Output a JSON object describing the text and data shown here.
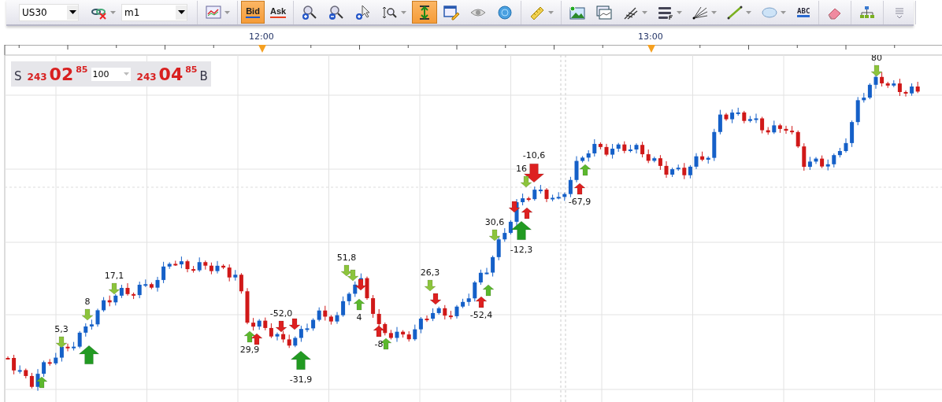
{
  "toolbar": {
    "groups": [
      {
        "items": [
          {
            "kind": "symbol-select",
            "value": "US30"
          },
          {
            "kind": "link",
            "selected": false,
            "dropdown": true
          },
          {
            "kind": "timeframe-select",
            "value": "m1"
          }
        ]
      },
      {
        "items": [
          {
            "kind": "chart-type",
            "selected": false,
            "dropdown": true
          }
        ]
      },
      {
        "items": [
          {
            "kind": "price-bid",
            "text": "Bid",
            "selected": true
          },
          {
            "kind": "price-ask",
            "text": "Ask",
            "selected": false
          }
        ]
      },
      {
        "items": [
          {
            "kind": "zoom-in",
            "selected": false
          },
          {
            "kind": "zoom-out",
            "selected": false
          },
          {
            "kind": "zoom-cursor",
            "selected": false
          },
          {
            "kind": "zoom-range",
            "selected": false,
            "dropdown": true
          },
          {
            "kind": "autoscale",
            "selected": true
          },
          {
            "kind": "properties",
            "selected": false
          },
          {
            "kind": "eye",
            "selected": false
          },
          {
            "kind": "globe",
            "selected": false
          }
        ]
      },
      {
        "items": [
          {
            "kind": "ruler",
            "selected": false,
            "dropdown": true
          }
        ]
      },
      {
        "items": [
          {
            "kind": "image",
            "selected": false
          },
          {
            "kind": "window",
            "selected": false
          },
          {
            "kind": "pitchfork",
            "selected": false,
            "dropdown": true
          },
          {
            "kind": "levels",
            "selected": false,
            "dropdown": true
          },
          {
            "kind": "fan",
            "selected": false,
            "dropdown": true
          },
          {
            "kind": "line",
            "selected": false,
            "dropdown": true
          },
          {
            "kind": "ellipse",
            "selected": false,
            "dropdown": true
          },
          {
            "kind": "text-tool",
            "text": "ABC",
            "selected": false
          }
        ]
      },
      {
        "items": [
          {
            "kind": "eraser",
            "selected": false
          }
        ]
      },
      {
        "items": [
          {
            "kind": "tree",
            "selected": false
          }
        ]
      },
      {
        "items": [
          {
            "kind": "overflow",
            "selected": false
          }
        ]
      }
    ]
  },
  "time_axis": {
    "labels": [
      "12:00",
      "13:00"
    ]
  },
  "quote": {
    "sell": {
      "side": "S",
      "big_figure": "243",
      "pips": "02",
      "fraction": "85"
    },
    "amount": {
      "value": "100"
    },
    "buy": {
      "side": "B",
      "big_figure": "243",
      "pips": "04",
      "fraction": "85"
    }
  },
  "markers": [
    {
      "kind": "up",
      "large": false,
      "color": "#5cb82e"
    },
    {
      "kind": "down",
      "large": false,
      "color": "#8cc43c",
      "label": "5,3"
    },
    {
      "kind": "down",
      "large": false,
      "color": "#8cc43c",
      "label": "8"
    },
    {
      "kind": "up",
      "large": true,
      "color": "#229a22"
    },
    {
      "kind": "down",
      "large": false,
      "color": "#8cc43c",
      "label": "17,1"
    },
    {
      "kind": "up",
      "large": false,
      "color": "#5cb82e",
      "label": "29,9"
    },
    {
      "kind": "up",
      "large": false,
      "color": "#dd2020"
    },
    {
      "kind": "down",
      "large": false,
      "color": "#dd2020",
      "label": "-52,0"
    },
    {
      "kind": "down",
      "large": false,
      "color": "#dd2020"
    },
    {
      "kind": "up",
      "large": true,
      "color": "#229a22",
      "label": "-31,9"
    },
    {
      "kind": "down",
      "large": false,
      "color": "#8cc43c",
      "label": "51,8"
    },
    {
      "kind": "down",
      "large": false,
      "color": "#8cc43c"
    },
    {
      "kind": "down",
      "large": false,
      "color": "#dd2020"
    },
    {
      "kind": "up",
      "large": false,
      "color": "#5cb82e",
      "label": "4"
    },
    {
      "kind": "up",
      "large": false,
      "color": "#dd2020",
      "label": "-8"
    },
    {
      "kind": "up",
      "large": false,
      "color": "#5cb82e"
    },
    {
      "kind": "down",
      "large": false,
      "color": "#8cc43c",
      "label": "26,3"
    },
    {
      "kind": "down",
      "large": false,
      "color": "#dd2020"
    },
    {
      "kind": "up",
      "large": false,
      "color": "#dd2020",
      "label": "-52,4"
    },
    {
      "kind": "up",
      "large": false,
      "color": "#5cb82e"
    },
    {
      "kind": "down",
      "large": false,
      "color": "#8cc43c",
      "label": "30,6"
    },
    {
      "kind": "up",
      "large": true,
      "color": "#229a22",
      "label": "-12,3"
    },
    {
      "kind": "down",
      "large": false,
      "color": "#dd2020"
    },
    {
      "kind": "up",
      "large": false,
      "color": "#dd2020"
    },
    {
      "kind": "down",
      "large": true,
      "color": "#dd2020",
      "label": "-10,6"
    },
    {
      "kind": "down",
      "large": false,
      "color": "#8cc43c",
      "label": "16"
    },
    {
      "kind": "up",
      "large": false,
      "color": "#dd2020",
      "label": "-67,9"
    },
    {
      "kind": "up",
      "large": false,
      "color": "#5cb82e"
    },
    {
      "kind": "down",
      "large": false,
      "color": "#8cc43c",
      "label": "80"
    }
  ]
}
